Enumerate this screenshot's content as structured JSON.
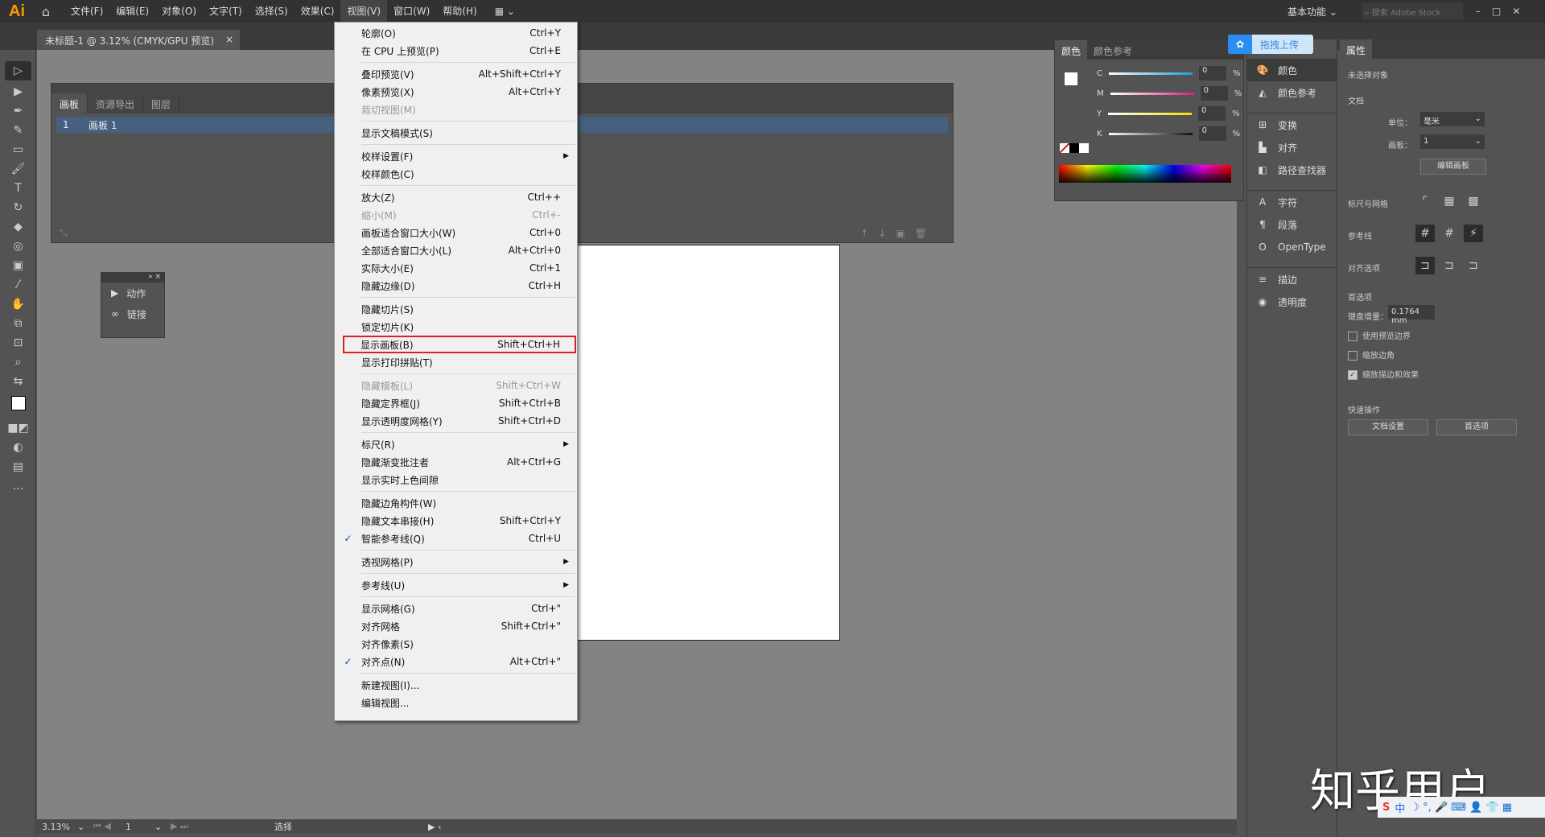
{
  "app": {
    "logo": "Ai",
    "menus": [
      "文件(F)",
      "编辑(E)",
      "对象(O)",
      "文字(T)",
      "选择(S)",
      "效果(C)",
      "视图(V)",
      "窗口(W)",
      "帮助(H)"
    ],
    "workspace": "基本功能",
    "search_placeholder": "搜索 Adobe Stock"
  },
  "doc_tab": {
    "title": "未标题-1 @ 3.12% (CMYK/GPU 预览)",
    "close": "×"
  },
  "artboards_panel": {
    "tabs": [
      "画板",
      "资源导出",
      "图层"
    ],
    "row": {
      "num": "1",
      "name": "画板 1"
    }
  },
  "actions_panel": {
    "items": [
      "动作",
      "链接"
    ]
  },
  "view_menu": {
    "items": [
      {
        "label": "轮廓(O)",
        "shortcut": "Ctrl+Y"
      },
      {
        "label": "在 CPU 上预览(P)",
        "shortcut": "Ctrl+E"
      },
      {
        "sep": true
      },
      {
        "label": "叠印预览(V)",
        "shortcut": "Alt+Shift+Ctrl+Y"
      },
      {
        "label": "像素预览(X)",
        "shortcut": "Alt+Ctrl+Y"
      },
      {
        "label": "裁切视图(M)",
        "shortcut": "",
        "disabled": true
      },
      {
        "sep": true
      },
      {
        "label": "显示文稿模式(S)",
        "shortcut": ""
      },
      {
        "sep": true
      },
      {
        "label": "校样设置(F)",
        "shortcut": "",
        "submenu": true
      },
      {
        "label": "校样颜色(C)",
        "shortcut": ""
      },
      {
        "sep": true
      },
      {
        "label": "放大(Z)",
        "shortcut": "Ctrl++"
      },
      {
        "label": "缩小(M)",
        "shortcut": "Ctrl+-",
        "disabled": true
      },
      {
        "label": "画板适合窗口大小(W)",
        "shortcut": "Ctrl+0"
      },
      {
        "label": "全部适合窗口大小(L)",
        "shortcut": "Alt+Ctrl+0"
      },
      {
        "label": "实际大小(E)",
        "shortcut": "Ctrl+1"
      },
      {
        "label": "隐藏边缘(D)",
        "shortcut": "Ctrl+H"
      },
      {
        "sep": true
      },
      {
        "label": "隐藏切片(S)",
        "shortcut": ""
      },
      {
        "label": "锁定切片(K)",
        "shortcut": ""
      },
      {
        "label": "显示画板(B)",
        "shortcut": "Shift+Ctrl+H",
        "highlighted": true
      },
      {
        "label": "显示打印拼贴(T)",
        "shortcut": ""
      },
      {
        "sep": true
      },
      {
        "label": "隐藏模板(L)",
        "shortcut": "Shift+Ctrl+W",
        "disabled": true
      },
      {
        "label": "隐藏定界框(J)",
        "shortcut": "Shift+Ctrl+B"
      },
      {
        "label": "显示透明度网格(Y)",
        "shortcut": "Shift+Ctrl+D"
      },
      {
        "sep": true
      },
      {
        "label": "标尺(R)",
        "shortcut": "",
        "submenu": true
      },
      {
        "label": "隐藏渐变批注者",
        "shortcut": "Alt+Ctrl+G"
      },
      {
        "label": "显示实时上色间隙",
        "shortcut": ""
      },
      {
        "sep": true
      },
      {
        "label": "隐藏边角构件(W)",
        "shortcut": ""
      },
      {
        "label": "隐藏文本串接(H)",
        "shortcut": "Shift+Ctrl+Y"
      },
      {
        "label": "智能参考线(Q)",
        "shortcut": "Ctrl+U",
        "checked": true
      },
      {
        "sep": true
      },
      {
        "label": "透视网格(P)",
        "shortcut": "",
        "submenu": true
      },
      {
        "sep": true
      },
      {
        "label": "参考线(U)",
        "shortcut": "",
        "submenu": true
      },
      {
        "sep": true
      },
      {
        "label": "显示网格(G)",
        "shortcut": "Ctrl+\""
      },
      {
        "label": "对齐网格",
        "shortcut": "Shift+Ctrl+\""
      },
      {
        "label": "对齐像素(S)",
        "shortcut": ""
      },
      {
        "label": "对齐点(N)",
        "shortcut": "Alt+Ctrl+\"",
        "checked": true
      },
      {
        "sep": true
      },
      {
        "label": "新建视图(I)...",
        "shortcut": ""
      },
      {
        "label": "编辑视图...",
        "shortcut": ""
      }
    ]
  },
  "color_panel": {
    "tabs": [
      "颜色",
      "颜色参考"
    ],
    "channels": [
      {
        "name": "C",
        "value": "0",
        "color": "#1aa0d8"
      },
      {
        "name": "M",
        "value": "0",
        "color": "#d8207a"
      },
      {
        "name": "Y",
        "value": "0",
        "color": "#f0e000"
      },
      {
        "name": "K",
        "value": "0",
        "color": "#111111"
      }
    ],
    "unit": "%"
  },
  "upload_badge": "拖拽上传",
  "icon_panel": {
    "items": [
      {
        "label": "颜色",
        "icon": "palette-icon"
      },
      {
        "label": "颜色参考",
        "icon": "color-guide-icon"
      },
      {
        "label": "变换",
        "icon": "transform-icon"
      },
      {
        "label": "对齐",
        "icon": "align-icon"
      },
      {
        "label": "路径查找器",
        "icon": "pathfinder-icon"
      },
      {
        "label": "字符",
        "icon": "character-icon"
      },
      {
        "label": "段落",
        "icon": "paragraph-icon"
      },
      {
        "label": "OpenType",
        "icon": "opentype-icon"
      },
      {
        "label": "描边",
        "icon": "stroke-icon"
      },
      {
        "label": "透明度",
        "icon": "transparency-icon"
      }
    ]
  },
  "properties": {
    "tab": "属性",
    "no_selection": "未选择对象",
    "document": "文档",
    "unit_label": "单位：",
    "unit_value": "毫米",
    "artboard_label": "画板：",
    "artboard_value": "1",
    "edit_artboard": "编辑画板",
    "rulers_grids": "标尺与网格",
    "guides": "参考线",
    "snap_options": "对齐选项",
    "preferences": "首选项",
    "keyboard_increment_label": "键盘增量：",
    "keyboard_increment_value": "0.1764 mm",
    "checkboxes": [
      {
        "label": "使用预览边界",
        "checked": false
      },
      {
        "label": "缩放边角",
        "checked": false
      },
      {
        "label": "缩放描边和效果",
        "checked": true
      }
    ],
    "quick_actions": "快速操作",
    "doc_setup": "文档设置",
    "prefs_button": "首选项"
  },
  "status": {
    "zoom": "3.13%",
    "artboard": "1",
    "tool": "选择"
  },
  "watermark": "知乎用户",
  "ime": "中"
}
